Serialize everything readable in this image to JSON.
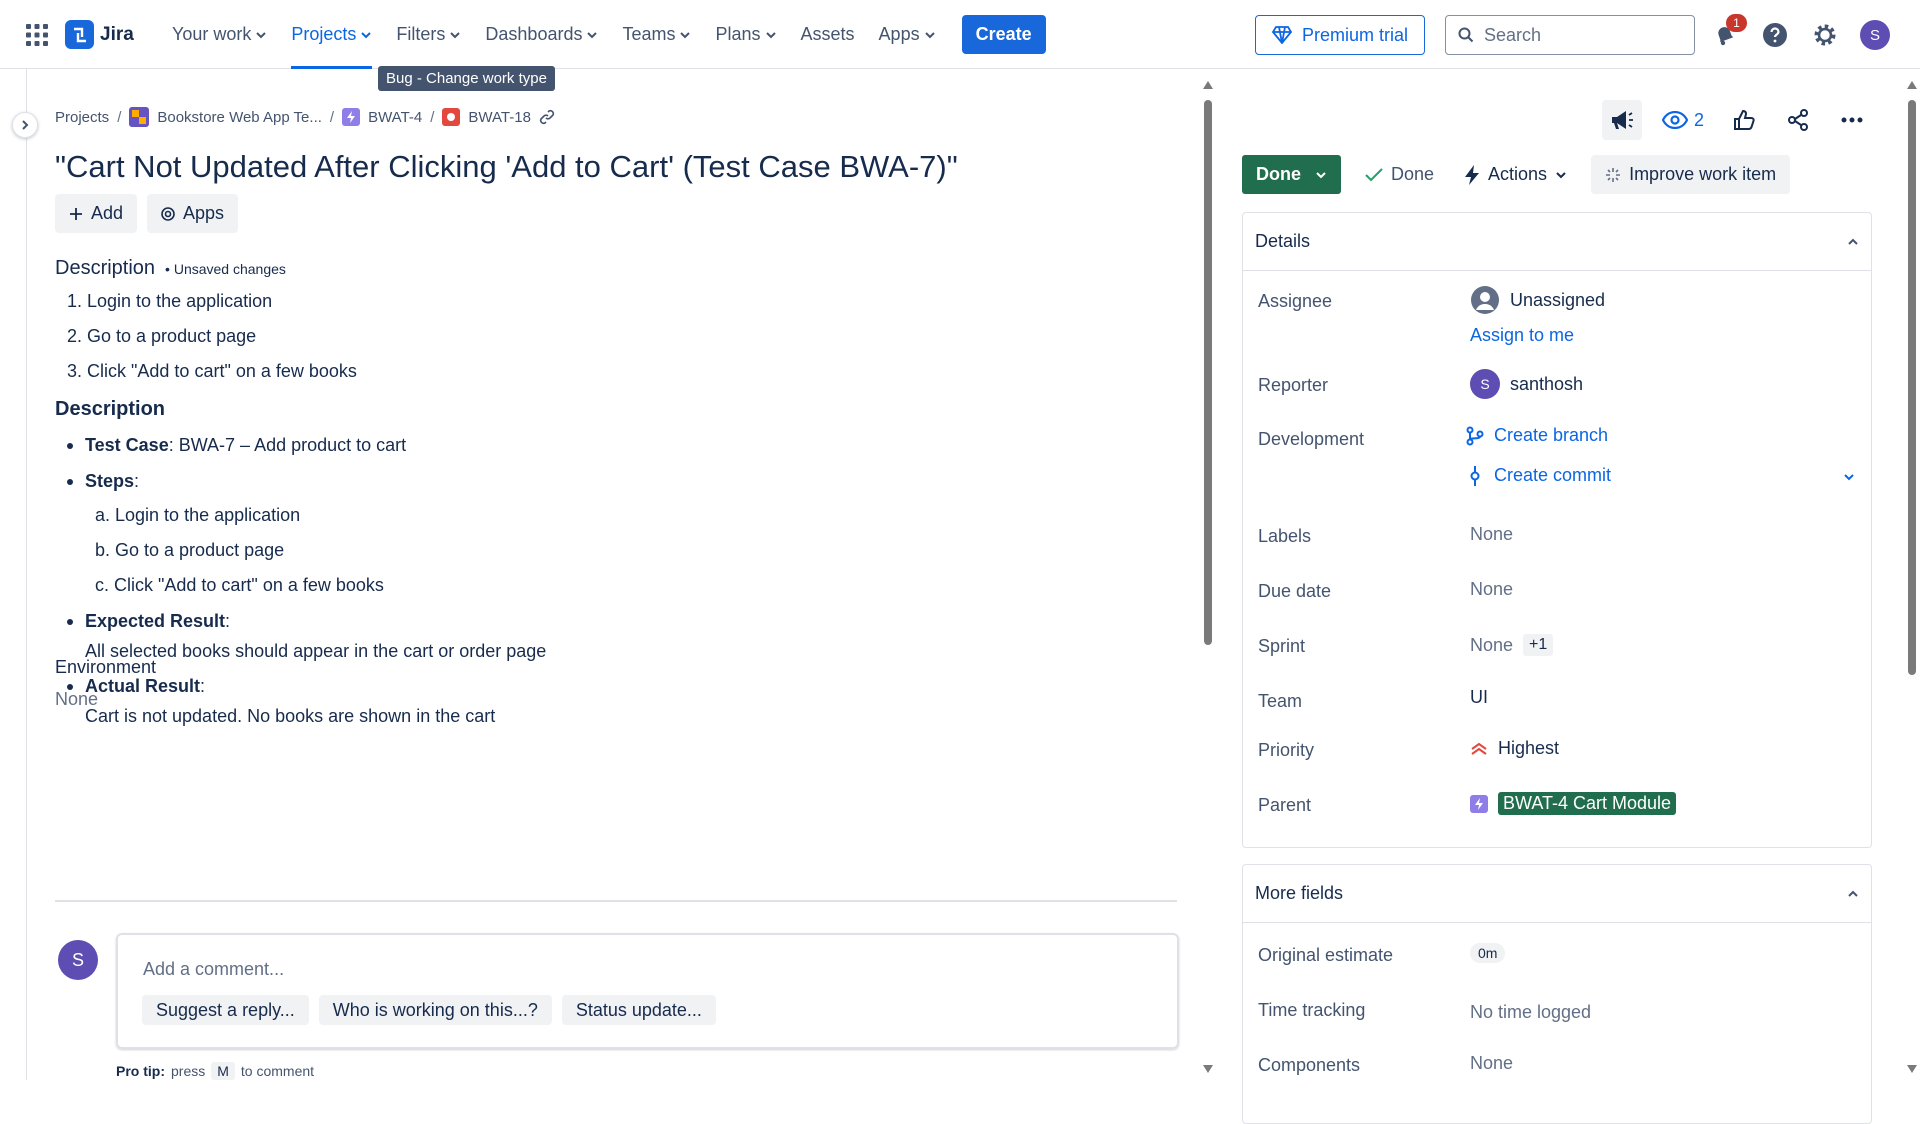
{
  "topbar": {
    "app_name": "Jira",
    "nav": [
      {
        "label": "Your work",
        "dropdown": true
      },
      {
        "label": "Projects",
        "dropdown": true,
        "active": true
      },
      {
        "label": "Filters",
        "dropdown": true
      },
      {
        "label": "Dashboards",
        "dropdown": true
      },
      {
        "label": "Teams",
        "dropdown": true
      },
      {
        "label": "Plans",
        "dropdown": true
      },
      {
        "label": "Assets",
        "dropdown": false
      },
      {
        "label": "Apps",
        "dropdown": true
      }
    ],
    "create_label": "Create",
    "premium_label": "Premium trial",
    "search_placeholder": "Search",
    "notification_count": "1",
    "user_initial": "S"
  },
  "tooltip": "Bug - Change work type",
  "breadcrumb": {
    "projects": "Projects",
    "project": "Bookstore Web App Te...",
    "parent": "BWAT-4",
    "issue": "BWAT-18"
  },
  "issue": {
    "title": "\"Cart Not Updated After Clicking 'Add to Cart' (Test Case BWA-7)\"",
    "add_label": "Add",
    "apps_label": "Apps"
  },
  "description": {
    "label": "Description",
    "unsaved": "• Unsaved changes",
    "steps": [
      "1. Login to the application",
      "2. Go to a product page",
      "3. Click \"Add to cart\" on a few books"
    ],
    "heading": "Description",
    "test_case_label": "Test Case",
    "test_case_value": ": BWA-7 – Add product to cart",
    "steps_label": "Steps",
    "steps_colon": ":",
    "sub_steps": [
      "a. Login to the application",
      "b. Go to a product page",
      "c. Click \"Add to cart\" on a few books"
    ],
    "expected_label": "Expected Result",
    "expected_colon": ":",
    "expected_value": "All selected books should appear in the cart or order page",
    "actual_label": "Actual Result",
    "actual_colon": ":",
    "actual_value": "Cart is not updated. No books are shown in the cart"
  },
  "environment": {
    "label": "Environment",
    "value": "None"
  },
  "comment": {
    "avatar": "S",
    "placeholder": "Add a comment...",
    "suggestions": [
      "Suggest a reply...",
      "Who is working on this...?",
      "Status update..."
    ],
    "protip_bold": "Pro tip:",
    "protip_press": "press",
    "protip_key": "M",
    "protip_rest": "to comment"
  },
  "right": {
    "watchers": "2",
    "status": "Done",
    "resolution": "Done",
    "actions": "Actions",
    "improve": "Improve work item",
    "details_title": "Details",
    "fields": {
      "assignee_label": "Assignee",
      "assignee_value": "Unassigned",
      "assign_to_me": "Assign to me",
      "reporter_label": "Reporter",
      "reporter_initial": "S",
      "reporter_value": "santhosh",
      "development_label": "Development",
      "create_branch": "Create branch",
      "create_commit": "Create commit",
      "labels_label": "Labels",
      "labels_value": "None",
      "due_label": "Due date",
      "due_value": "None",
      "sprint_label": "Sprint",
      "sprint_value": "None",
      "sprint_extra": "+1",
      "team_label": "Team",
      "team_value": "UI",
      "priority_label": "Priority",
      "priority_value": "Highest",
      "parent_label": "Parent",
      "parent_value": "BWAT-4 Cart Module"
    },
    "more_title": "More fields",
    "more": {
      "estimate_label": "Original estimate",
      "estimate_value": "0m",
      "tracking_label": "Time tracking",
      "tracking_value": "No time logged",
      "components_label": "Components",
      "components_value": "None"
    }
  },
  "colors": {
    "brand": "#1868db",
    "link": "#0c66e4",
    "done": "#216e4e",
    "avatar": "#5e4db2",
    "badge": "#c9372c"
  }
}
